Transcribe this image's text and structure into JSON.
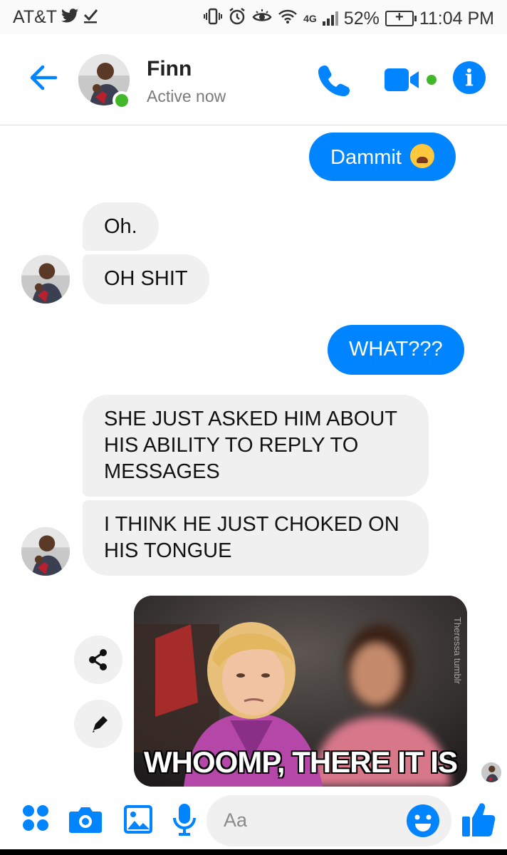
{
  "status_bar": {
    "carrier": "AT&T",
    "network": "4G",
    "battery": "52%",
    "time": "11:04 PM"
  },
  "header": {
    "name": "Finn",
    "status": "Active now"
  },
  "messages": {
    "m1": "Dammit",
    "m2": "Oh.",
    "m3": "OH SHIT",
    "m4": "WHAT???",
    "m5": "SHE JUST ASKED HIM ABOUT HIS ABILITY TO REPLY TO MESSAGES",
    "m6": "I THINK HE JUST CHOKED ON HIS TONGUE"
  },
  "gif": {
    "caption": "WHOOMP, THERE IT IS",
    "watermark": "Theressa tumblr"
  },
  "composer": {
    "placeholder": "Aa"
  },
  "colors": {
    "accent": "#0084ff",
    "incoming_bubble": "#f1f0f0",
    "online": "#42b72a"
  }
}
